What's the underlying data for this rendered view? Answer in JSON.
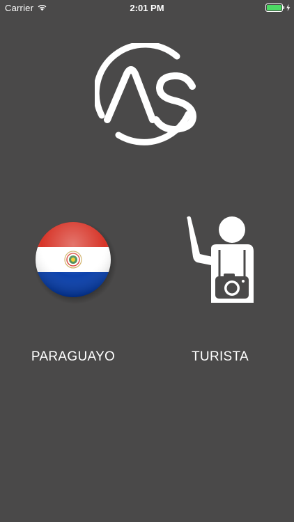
{
  "status_bar": {
    "carrier": "Carrier",
    "time": "2:01 PM",
    "wifi_icon": "wifi-icon",
    "battery_icon": "battery-icon",
    "battery_color": "#4cd964"
  },
  "logo": {
    "icon": "as-logo-icon"
  },
  "choices": [
    {
      "label": "PARAGUAYO",
      "icon": "paraguay-flag-icon"
    },
    {
      "label": "TURISTA",
      "icon": "tourist-camera-icon"
    }
  ],
  "colors": {
    "background": "#4a4949",
    "text": "#ffffff",
    "flag_red": "#d52b1e",
    "flag_blue": "#0038a8"
  }
}
